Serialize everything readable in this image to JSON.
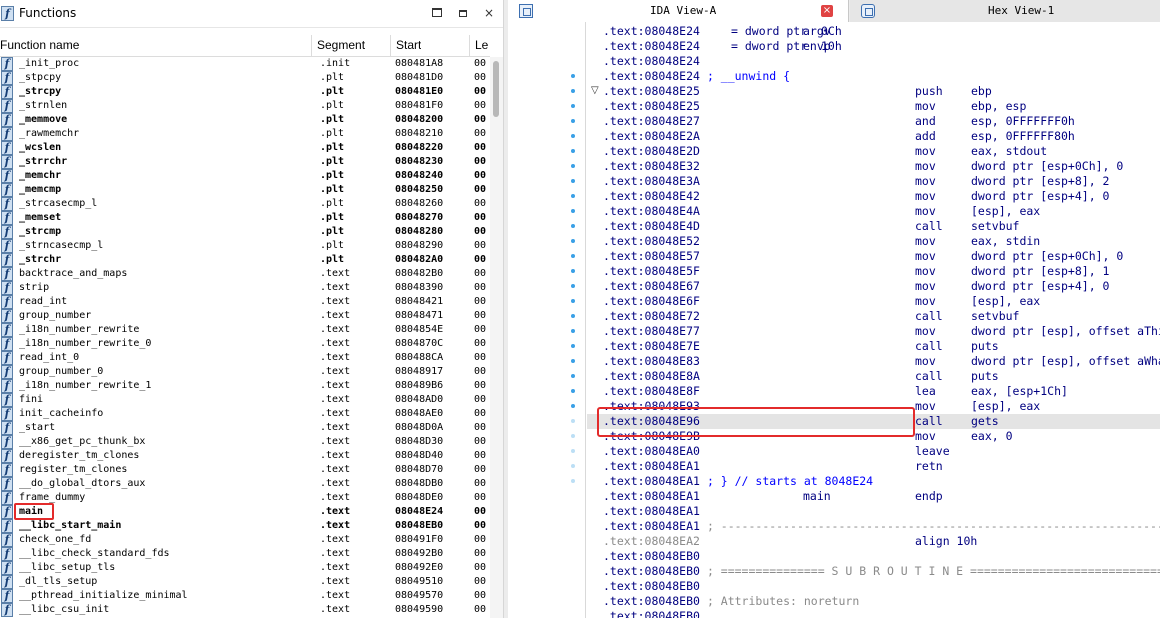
{
  "functions_window": {
    "title": "Functions",
    "controls": {
      "maximize": "maximize-icon",
      "restore": "restore-icon",
      "close": "×"
    },
    "columns": [
      "Function name",
      "Segment",
      "Start",
      "Le"
    ],
    "rows": [
      {
        "name": "_init_proc",
        "segment": ".init",
        "start": "080481A8",
        "len": "00",
        "bold": false
      },
      {
        "name": "_stpcpy",
        "segment": ".plt",
        "start": "080481D0",
        "len": "00",
        "bold": false
      },
      {
        "name": "_strcpy",
        "segment": ".plt",
        "start": "080481E0",
        "len": "00",
        "bold": true
      },
      {
        "name": "_strnlen",
        "segment": ".plt",
        "start": "080481F0",
        "len": "00",
        "bold": false
      },
      {
        "name": "_memmove",
        "segment": ".plt",
        "start": "08048200",
        "len": "00",
        "bold": true
      },
      {
        "name": "_rawmemchr",
        "segment": ".plt",
        "start": "08048210",
        "len": "00",
        "bold": false
      },
      {
        "name": "_wcslen",
        "segment": ".plt",
        "start": "08048220",
        "len": "00",
        "bold": true
      },
      {
        "name": "_strrchr",
        "segment": ".plt",
        "start": "08048230",
        "len": "00",
        "bold": true
      },
      {
        "name": "_memchr",
        "segment": ".plt",
        "start": "08048240",
        "len": "00",
        "bold": true
      },
      {
        "name": "_memcmp",
        "segment": ".plt",
        "start": "08048250",
        "len": "00",
        "bold": true
      },
      {
        "name": "_strcasecmp_l",
        "segment": ".plt",
        "start": "08048260",
        "len": "00",
        "bold": false
      },
      {
        "name": "_memset",
        "segment": ".plt",
        "start": "08048270",
        "len": "00",
        "bold": true
      },
      {
        "name": "_strcmp",
        "segment": ".plt",
        "start": "08048280",
        "len": "00",
        "bold": true
      },
      {
        "name": "_strncasecmp_l",
        "segment": ".plt",
        "start": "08048290",
        "len": "00",
        "bold": false
      },
      {
        "name": "_strchr",
        "segment": ".plt",
        "start": "080482A0",
        "len": "00",
        "bold": true
      },
      {
        "name": "backtrace_and_maps",
        "segment": ".text",
        "start": "080482B0",
        "len": "00",
        "bold": false
      },
      {
        "name": "strip",
        "segment": ".text",
        "start": "08048390",
        "len": "00",
        "bold": false
      },
      {
        "name": "read_int",
        "segment": ".text",
        "start": "08048421",
        "len": "00",
        "bold": false
      },
      {
        "name": "group_number",
        "segment": ".text",
        "start": "08048471",
        "len": "00",
        "bold": false
      },
      {
        "name": "_i18n_number_rewrite",
        "segment": ".text",
        "start": "0804854E",
        "len": "00",
        "bold": false
      },
      {
        "name": "_i18n_number_rewrite_0",
        "segment": ".text",
        "start": "0804870C",
        "len": "00",
        "bold": false
      },
      {
        "name": "read_int_0",
        "segment": ".text",
        "start": "080488CA",
        "len": "00",
        "bold": false
      },
      {
        "name": "group_number_0",
        "segment": ".text",
        "start": "08048917",
        "len": "00",
        "bold": false
      },
      {
        "name": "_i18n_number_rewrite_1",
        "segment": ".text",
        "start": "080489B6",
        "len": "00",
        "bold": false
      },
      {
        "name": "fini",
        "segment": ".text",
        "start": "08048AD0",
        "len": "00",
        "bold": false
      },
      {
        "name": "init_cacheinfo",
        "segment": ".text",
        "start": "08048AE0",
        "len": "00",
        "bold": false
      },
      {
        "name": "_start",
        "segment": ".text",
        "start": "08048D0A",
        "len": "00",
        "bold": false
      },
      {
        "name": "__x86_get_pc_thunk_bx",
        "segment": ".text",
        "start": "08048D30",
        "len": "00",
        "bold": false
      },
      {
        "name": "deregister_tm_clones",
        "segment": ".text",
        "start": "08048D40",
        "len": "00",
        "bold": false
      },
      {
        "name": "register_tm_clones",
        "segment": ".text",
        "start": "08048D70",
        "len": "00",
        "bold": false
      },
      {
        "name": "__do_global_dtors_aux",
        "segment": ".text",
        "start": "08048DB0",
        "len": "00",
        "bold": false
      },
      {
        "name": "frame_dummy",
        "segment": ".text",
        "start": "08048DE0",
        "len": "00",
        "bold": false
      },
      {
        "name": "main",
        "segment": ".text",
        "start": "08048E24",
        "len": "00",
        "bold": true
      },
      {
        "name": "__libc_start_main",
        "segment": ".text",
        "start": "08048EB0",
        "len": "00",
        "bold": true
      },
      {
        "name": "check_one_fd",
        "segment": ".text",
        "start": "080491F0",
        "len": "00",
        "bold": false
      },
      {
        "name": "__libc_check_standard_fds",
        "segment": ".text",
        "start": "080492B0",
        "len": "00",
        "bold": false
      },
      {
        "name": "__libc_setup_tls",
        "segment": ".text",
        "start": "080492E0",
        "len": "00",
        "bold": false
      },
      {
        "name": "_dl_tls_setup",
        "segment": ".text",
        "start": "08049510",
        "len": "00",
        "bold": false
      },
      {
        "name": "__pthread_initialize_minimal",
        "segment": ".text",
        "start": "08049570",
        "len": "00",
        "bold": false
      },
      {
        "name": "__libc_csu_init",
        "segment": ".text",
        "start": "08049590",
        "len": "00",
        "bold": false
      }
    ]
  },
  "tabs": {
    "ida_view": {
      "label": "IDA View-A",
      "close": "×"
    },
    "hex_view": {
      "label": "Hex View-1"
    }
  },
  "disasm": {
    "lines": [
      {
        "addr": ".text:08048E24",
        "sym": "argv",
        "mn": "= dword ptr  0Ch",
        "op": "",
        "kind": "code"
      },
      {
        "addr": ".text:08048E24",
        "sym": "envp",
        "mn": "= dword ptr  10h",
        "op": "",
        "kind": "code"
      },
      {
        "addr": ".text:08048E24",
        "sym": "",
        "mn": "",
        "op": "",
        "kind": "code"
      },
      {
        "addr": ".text:08048E24",
        "comment": "; __unwind {",
        "kind": "comment"
      },
      {
        "addr": ".text:08048E25",
        "sym": "",
        "mn": "push",
        "op": "ebp",
        "kind": "code"
      },
      {
        "addr": ".text:08048E25",
        "sym": "",
        "mn": "mov",
        "op": "ebp, esp",
        "kind": "code"
      },
      {
        "addr": ".text:08048E27",
        "sym": "",
        "mn": "and",
        "op": "esp, 0FFFFFFF0h",
        "kind": "code"
      },
      {
        "addr": ".text:08048E2A",
        "sym": "",
        "mn": "add",
        "op": "esp, 0FFFFFF80h",
        "kind": "code"
      },
      {
        "addr": ".text:08048E2D",
        "sym": "",
        "mn": "mov",
        "op": "eax, stdout",
        "kind": "code"
      },
      {
        "addr": ".text:08048E32",
        "sym": "",
        "mn": "mov",
        "op": "dword ptr [esp+0Ch], 0",
        "kind": "code"
      },
      {
        "addr": ".text:08048E3A",
        "sym": "",
        "mn": "mov",
        "op": "dword ptr [esp+8], 2",
        "kind": "code"
      },
      {
        "addr": ".text:08048E42",
        "sym": "",
        "mn": "mov",
        "op": "dword ptr [esp+4], 0",
        "kind": "code"
      },
      {
        "addr": ".text:08048E4A",
        "sym": "",
        "mn": "mov",
        "op": "[esp], eax",
        "kind": "code"
      },
      {
        "addr": ".text:08048E4D",
        "sym": "",
        "mn": "call",
        "op": "setvbuf",
        "kind": "code"
      },
      {
        "addr": ".text:08048E52",
        "sym": "",
        "mn": "mov",
        "op": "eax, stdin",
        "kind": "code"
      },
      {
        "addr": ".text:08048E57",
        "sym": "",
        "mn": "mov",
        "op": "dword ptr [esp+0Ch], 0",
        "kind": "code"
      },
      {
        "addr": ".text:08048E5F",
        "sym": "",
        "mn": "mov",
        "op": "dword ptr [esp+8], 1",
        "kind": "code"
      },
      {
        "addr": ".text:08048E67",
        "sym": "",
        "mn": "mov",
        "op": "dword ptr [esp+4], 0",
        "kind": "code"
      },
      {
        "addr": ".text:08048E6F",
        "sym": "",
        "mn": "mov",
        "op": "[esp], eax",
        "kind": "code"
      },
      {
        "addr": ".text:08048E72",
        "sym": "",
        "mn": "call",
        "op": "setvbuf",
        "kind": "code"
      },
      {
        "addr": ".text:08048E77",
        "sym": "",
        "mn": "mov",
        "op": "dword ptr [esp], offset aThisTimeNoSyst ;",
        "kind": "code"
      },
      {
        "addr": ".text:08048E7E",
        "sym": "",
        "mn": "call",
        "op": "puts",
        "kind": "code"
      },
      {
        "addr": ".text:08048E83",
        "sym": "",
        "mn": "mov",
        "op": "dword ptr [esp], offset aWhatDoYouPlanT ;",
        "kind": "code"
      },
      {
        "addr": ".text:08048E8A",
        "sym": "",
        "mn": "call",
        "op": "puts",
        "kind": "code"
      },
      {
        "addr": ".text:08048E8F",
        "sym": "",
        "mn": "lea",
        "op": "eax, [esp+1Ch]",
        "kind": "code"
      },
      {
        "addr": ".text:08048E93",
        "sym": "",
        "mn": "mov",
        "op": "[esp], eax",
        "kind": "code"
      },
      {
        "addr": ".text:08048E96",
        "sym": "",
        "mn": "call",
        "op": "gets",
        "kind": "code",
        "selected": true
      },
      {
        "addr": ".text:08048E9B",
        "sym": "",
        "mn": "mov",
        "op": "eax, 0",
        "kind": "code"
      },
      {
        "addr": ".text:08048EA0",
        "sym": "",
        "mn": "leave",
        "op": "",
        "kind": "code"
      },
      {
        "addr": ".text:08048EA1",
        "sym": "",
        "mn": "retn",
        "op": "",
        "kind": "code"
      },
      {
        "addr": ".text:08048EA1",
        "comment": "; } // starts at 8048E24",
        "kind": "comment"
      },
      {
        "addr": ".text:08048EA1",
        "sym": "main",
        "mn": "endp",
        "op": "",
        "kind": "code"
      },
      {
        "addr": ".text:08048EA1",
        "sym": "",
        "mn": "",
        "op": "",
        "kind": "code"
      },
      {
        "addr": ".text:08048EA1",
        "comment": "; -------------------------------------------------------------------",
        "kind": "faded"
      },
      {
        "addr": ".text:08048EA2",
        "sym": "",
        "mn": "align 10h",
        "op": "",
        "kind": "faded-addr"
      },
      {
        "addr": ".text:08048EB0",
        "sym": "",
        "mn": "",
        "op": "",
        "kind": "code"
      },
      {
        "addr": ".text:08048EB0",
        "comment": "; =============== S U B R O U T I N E =======================================",
        "kind": "faded"
      },
      {
        "addr": ".text:08048EB0",
        "sym": "",
        "mn": "",
        "op": "",
        "kind": "code"
      },
      {
        "addr": ".text:08048EB0",
        "comment": "; Attributes: noreturn",
        "kind": "faded"
      },
      {
        "addr": ".text:08048EB0",
        "sym": "",
        "mn": "",
        "op": "",
        "kind": "code"
      }
    ]
  }
}
